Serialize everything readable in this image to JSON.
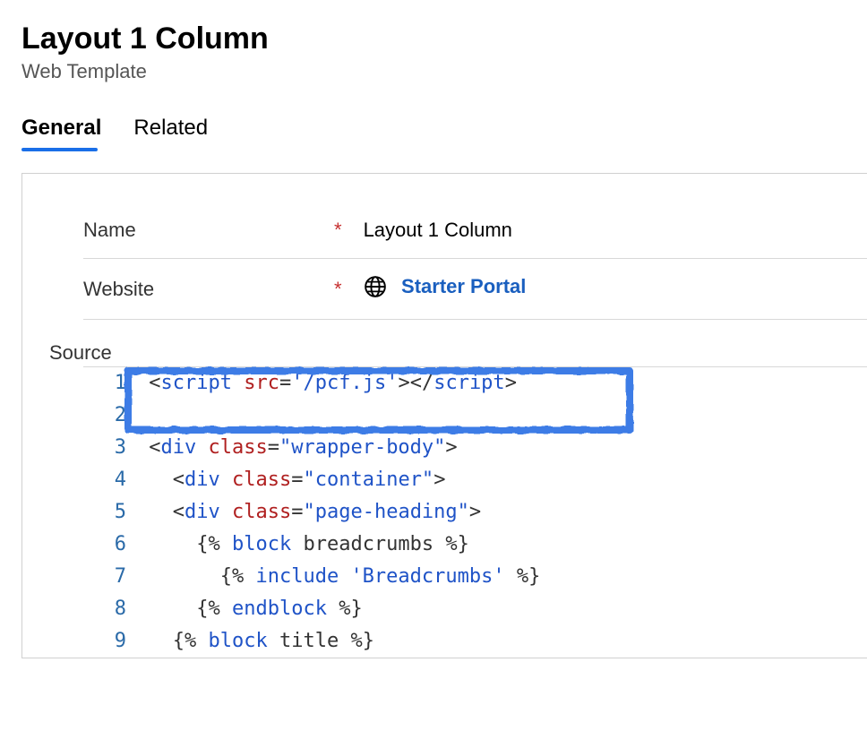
{
  "header": {
    "title": "Layout 1 Column",
    "subtitle": "Web Template"
  },
  "tabs": [
    {
      "label": "General",
      "active": true
    },
    {
      "label": "Related",
      "active": false
    }
  ],
  "form": {
    "name_label": "Name",
    "name_value": "Layout 1 Column",
    "website_label": "Website",
    "website_value": "Starter Portal",
    "required_mark": "*",
    "source_label": "Source"
  },
  "code": {
    "lines": [
      {
        "n": 1,
        "tokens": [
          [
            "txt",
            " "
          ],
          [
            "punc",
            "<"
          ],
          [
            "tag",
            "script"
          ],
          [
            "txt",
            " "
          ],
          [
            "attr",
            "src"
          ],
          [
            "punc",
            "="
          ],
          [
            "str",
            "'/pcf.js'"
          ],
          [
            "punc",
            "></"
          ],
          [
            "tag",
            "script"
          ],
          [
            "punc",
            ">"
          ]
        ]
      },
      {
        "n": 2,
        "tokens": []
      },
      {
        "n": 3,
        "tokens": [
          [
            "txt",
            " "
          ],
          [
            "punc",
            "<"
          ],
          [
            "tag",
            "div"
          ],
          [
            "txt",
            " "
          ],
          [
            "attr",
            "class"
          ],
          [
            "punc",
            "="
          ],
          [
            "str",
            "\"wrapper-body\""
          ],
          [
            "punc",
            ">"
          ]
        ]
      },
      {
        "n": 4,
        "tokens": [
          [
            "txt",
            "   "
          ],
          [
            "punc",
            "<"
          ],
          [
            "tag",
            "div"
          ],
          [
            "txt",
            " "
          ],
          [
            "attr",
            "class"
          ],
          [
            "punc",
            "="
          ],
          [
            "str",
            "\"container\""
          ],
          [
            "punc",
            ">"
          ]
        ]
      },
      {
        "n": 5,
        "tokens": [
          [
            "txt",
            "   "
          ],
          [
            "punc",
            "<"
          ],
          [
            "tag",
            "div"
          ],
          [
            "txt",
            " "
          ],
          [
            "attr",
            "class"
          ],
          [
            "punc",
            "="
          ],
          [
            "str",
            "\"page-heading\""
          ],
          [
            "punc",
            ">"
          ]
        ]
      },
      {
        "n": 6,
        "tokens": [
          [
            "txt",
            "     "
          ],
          [
            "liq",
            "{% "
          ],
          [
            "liqkw",
            "block"
          ],
          [
            "txt",
            " breadcrumbs "
          ],
          [
            "liq",
            "%}"
          ]
        ]
      },
      {
        "n": 7,
        "tokens": [
          [
            "txt",
            "       "
          ],
          [
            "liq",
            "{% "
          ],
          [
            "liqkw",
            "include"
          ],
          [
            "txt",
            " "
          ],
          [
            "str",
            "'Breadcrumbs'"
          ],
          [
            "txt",
            " "
          ],
          [
            "liq",
            "%}"
          ]
        ]
      },
      {
        "n": 8,
        "tokens": [
          [
            "txt",
            "     "
          ],
          [
            "liq",
            "{% "
          ],
          [
            "liqkw",
            "endblock"
          ],
          [
            "txt",
            " "
          ],
          [
            "liq",
            "%}"
          ]
        ]
      },
      {
        "n": 9,
        "tokens": [
          [
            "txt",
            "   "
          ],
          [
            "liq",
            "{% "
          ],
          [
            "liqkw",
            "block"
          ],
          [
            "txt",
            " title "
          ],
          [
            "liq",
            "%}"
          ]
        ]
      }
    ]
  }
}
